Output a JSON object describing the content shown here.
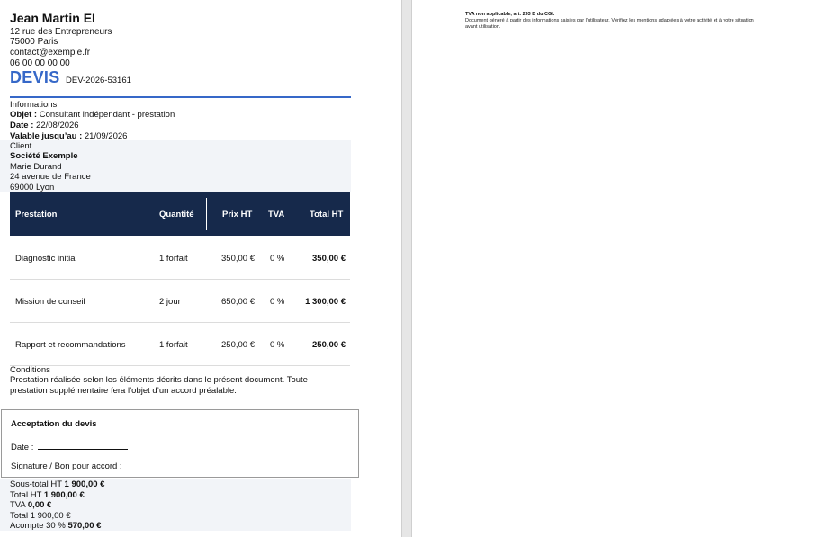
{
  "sender": {
    "name": "Jean Martin EI",
    "address1": "12 rue des Entrepreneurs",
    "address2": "75000 Paris",
    "email": "contact@exemple.fr",
    "phone": "06 00 00 00 00"
  },
  "document": {
    "title": "DEVIS",
    "number": "DEV-2026-53161"
  },
  "info": {
    "heading": "Informations",
    "object_label": "Objet :",
    "object_value": " Consultant indépendant - prestation",
    "date_label": "Date :",
    "date_value": " 22/08/2026",
    "valid_label": "Valable jusqu’au :",
    "valid_value": " 21/09/2026"
  },
  "client": {
    "heading": "Client",
    "company": "Société Exemple",
    "contact": "Marie Durand",
    "address1": "24 avenue de France",
    "address2": "69000 Lyon"
  },
  "table": {
    "headers": {
      "prestation": "Prestation",
      "quantite": "Quantité",
      "prix": "Prix HT",
      "tva": "TVA",
      "total": "Total HT"
    },
    "rows": [
      {
        "prestation": "Diagnostic initial",
        "quantite": "1 forfait",
        "prix": "350,00 €",
        "tva": "0 %",
        "total": "350,00 €"
      },
      {
        "prestation": "Mission de conseil",
        "quantite": "2 jour",
        "prix": "650,00 €",
        "tva": "0 %",
        "total": "1 300,00 €"
      },
      {
        "prestation": "Rapport et recommandations",
        "quantite": "1 forfait",
        "prix": "250,00 €",
        "tva": "0 %",
        "total": "250,00 €"
      }
    ]
  },
  "conditions": {
    "heading": "Conditions",
    "line1": "Prestation réalisée selon les éléments décrits dans le présent document. Toute",
    "line2": "prestation supplémentaire fera l’objet d’un accord préalable."
  },
  "acceptance": {
    "title": "Acceptation du devis",
    "date_label": "Date :",
    "signature_label": "Signature / Bon pour accord :"
  },
  "totals": {
    "subtotal_label": "Sous-total HT",
    "subtotal_value": "1 900,00 €",
    "total_ht_label": "Total HT",
    "total_ht_value": "1 900,00 €",
    "tva_label": "TVA",
    "tva_value": "0,00 €",
    "total_label": "Total",
    "total_value": "1 900,00 €",
    "acompte_label": "Acompte 30 %",
    "acompte_value": "570,00 €"
  },
  "notes": {
    "title": "TVA non applicable, art. 293 B du CGI.",
    "line1": "Document généré à partir des informations saisies par l’utilisateur. Vérifiez les mentions adaptées à votre activité et à votre situation",
    "line2": "avant utilisation."
  },
  "colors": {
    "accent": "#3668c8",
    "table_header": "#16294b",
    "panel_bg": "#f2f4f8"
  }
}
